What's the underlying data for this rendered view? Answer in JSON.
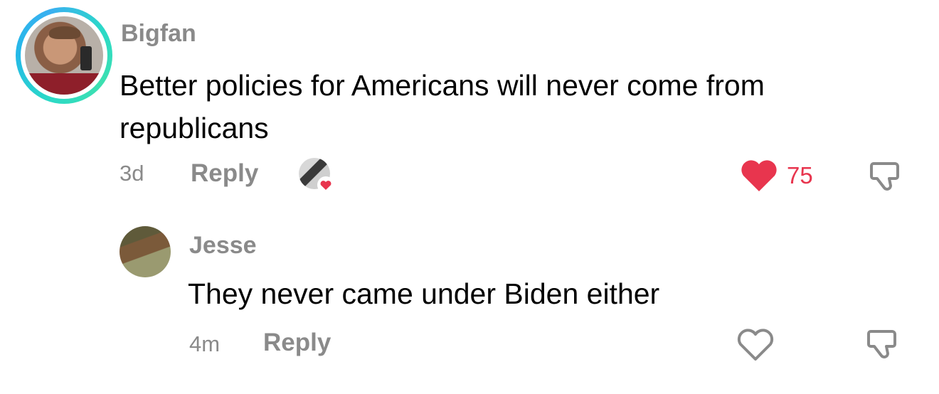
{
  "comments": [
    {
      "username": "Bigfan",
      "text": "Better policies for Americans will never come from republicans",
      "time": "3d",
      "reply_label": "Reply",
      "like_count": "75",
      "liked": true,
      "creator_liked": true
    }
  ],
  "replies": [
    {
      "username": "Jesse",
      "text": "They never came under Biden either",
      "time": "4m",
      "reply_label": "Reply",
      "liked": false
    }
  ],
  "colors": {
    "like_red": "#e8354e",
    "gray_text": "#8a8a8a",
    "story_ring": "#2bd9c7"
  },
  "icons": [
    "heart-icon",
    "dislike-icon",
    "creator-liked-heart-icon"
  ]
}
